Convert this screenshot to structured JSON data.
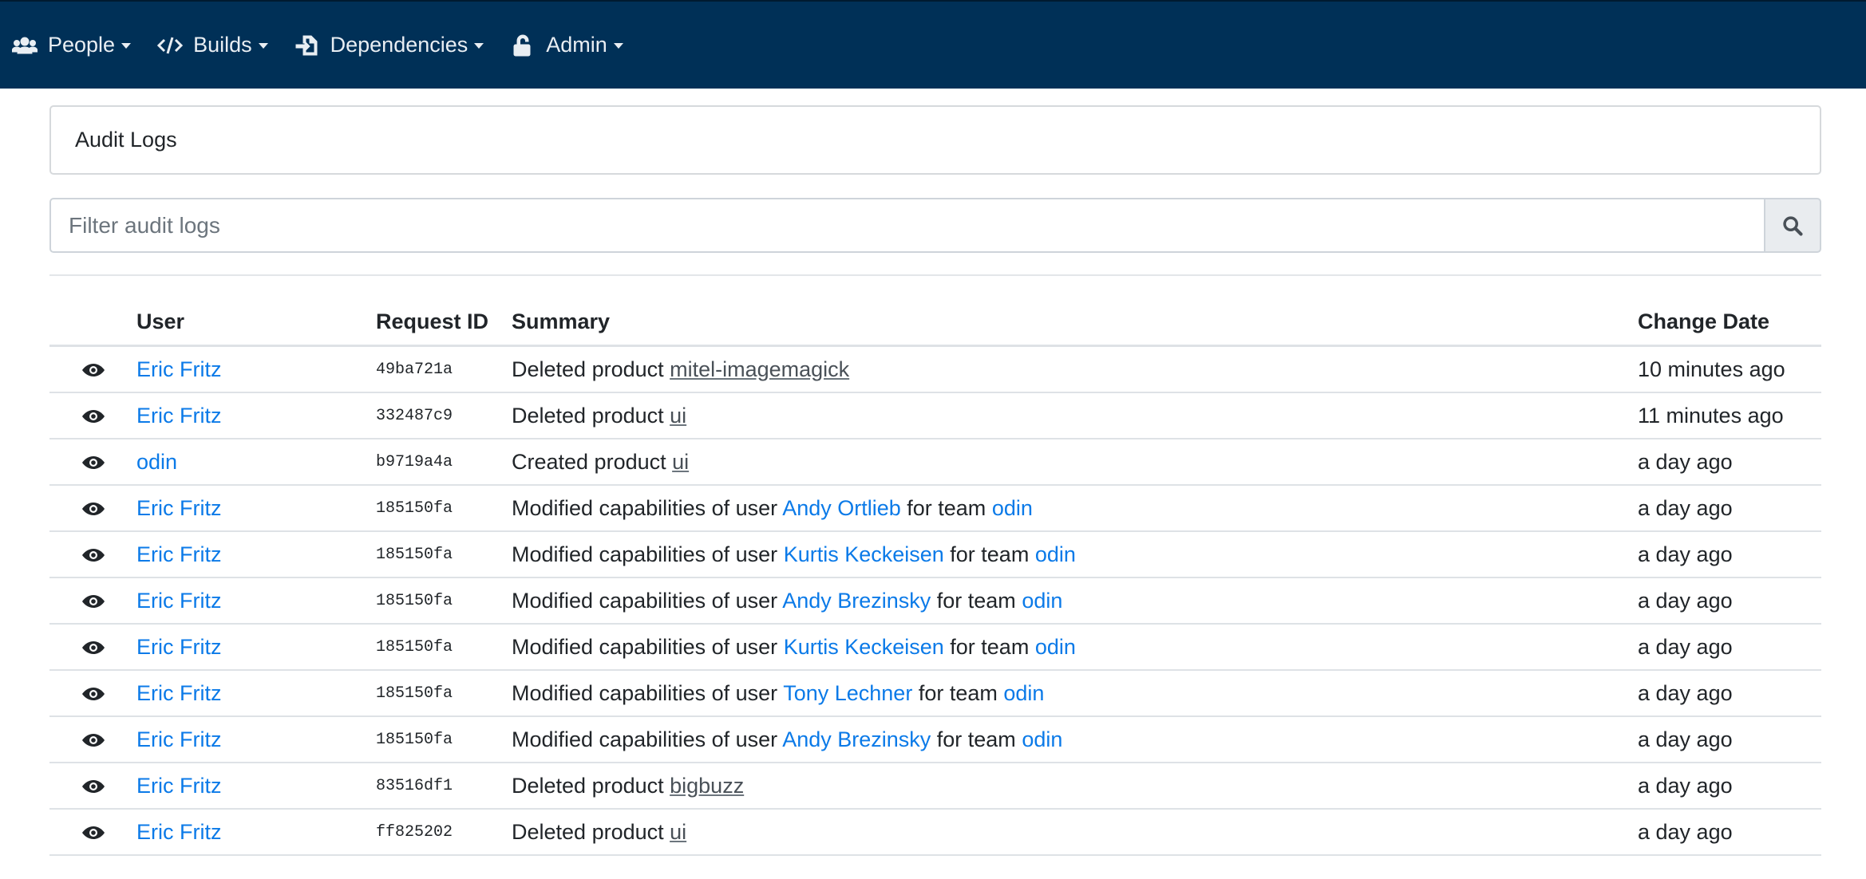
{
  "nav": {
    "items": [
      {
        "label": "People",
        "icon": "users-icon"
      },
      {
        "label": "Builds",
        "icon": "code-icon"
      },
      {
        "label": "Dependencies",
        "icon": "file-import-icon"
      },
      {
        "label": "Admin",
        "icon": "unlock-icon"
      }
    ]
  },
  "page": {
    "title": "Audit Logs"
  },
  "search": {
    "placeholder": "Filter audit logs"
  },
  "table": {
    "headers": {
      "user": "User",
      "request_id": "Request ID",
      "summary": "Summary",
      "change_date": "Change Date"
    },
    "rows": [
      {
        "user": "Eric Fritz",
        "request_id": "49ba721a",
        "prefix": "Deleted product ",
        "product": "mitel-imagemagick",
        "date": "10 minutes ago"
      },
      {
        "user": "Eric Fritz",
        "request_id": "332487c9",
        "prefix": "Deleted product ",
        "product": "ui",
        "date": "11 minutes ago"
      },
      {
        "user": "odin",
        "request_id": "b9719a4a",
        "prefix": "Created product ",
        "product": "ui",
        "date": "a day ago"
      },
      {
        "user": "Eric Fritz",
        "request_id": "185150fa",
        "prefix": "Modified capabilities of user ",
        "target_user": "Andy Ortlieb",
        "middle": " for team ",
        "team": "odin",
        "date": "a day ago"
      },
      {
        "user": "Eric Fritz",
        "request_id": "185150fa",
        "prefix": "Modified capabilities of user ",
        "target_user": "Kurtis Keckeisen",
        "middle": " for team ",
        "team": "odin",
        "date": "a day ago"
      },
      {
        "user": "Eric Fritz",
        "request_id": "185150fa",
        "prefix": "Modified capabilities of user ",
        "target_user": "Andy Brezinsky",
        "middle": " for team ",
        "team": "odin",
        "date": "a day ago"
      },
      {
        "user": "Eric Fritz",
        "request_id": "185150fa",
        "prefix": "Modified capabilities of user ",
        "target_user": "Kurtis Keckeisen",
        "middle": " for team ",
        "team": "odin",
        "date": "a day ago"
      },
      {
        "user": "Eric Fritz",
        "request_id": "185150fa",
        "prefix": "Modified capabilities of user ",
        "target_user": "Tony Lechner",
        "middle": " for team ",
        "team": "odin",
        "date": "a day ago"
      },
      {
        "user": "Eric Fritz",
        "request_id": "185150fa",
        "prefix": "Modified capabilities of user ",
        "target_user": "Andy Brezinsky",
        "middle": " for team ",
        "team": "odin",
        "date": "a day ago"
      },
      {
        "user": "Eric Fritz",
        "request_id": "83516df1",
        "prefix": "Deleted product ",
        "product": "bigbuzz",
        "date": "a day ago"
      },
      {
        "user": "Eric Fritz",
        "request_id": "ff825202",
        "prefix": "Deleted product ",
        "product": "ui",
        "date": "a day ago"
      }
    ]
  },
  "colors": {
    "navbar": "#003057",
    "link": "#0b7ae8"
  }
}
